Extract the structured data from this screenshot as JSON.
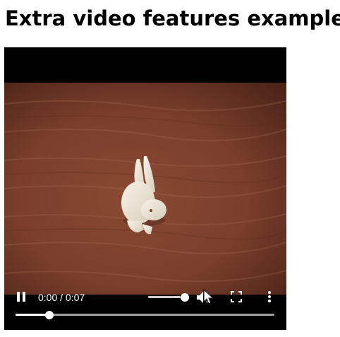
{
  "page": {
    "title": "Extra video features example"
  },
  "video": {
    "time_display": "0:00 / 0:07",
    "playback_progress": 0.13,
    "volume_level": 1.0,
    "state": "playing",
    "icons": {
      "pause": "pause-icon",
      "volume": "volume-icon",
      "fullscreen": "fullscreen-icon",
      "more": "more-options-icon",
      "cursor": "mouse-cursor-icon"
    }
  },
  "colors": {
    "background": "#ffffff",
    "player": "#000000",
    "controls": "#ffffff",
    "track": "#9e9e9e"
  }
}
